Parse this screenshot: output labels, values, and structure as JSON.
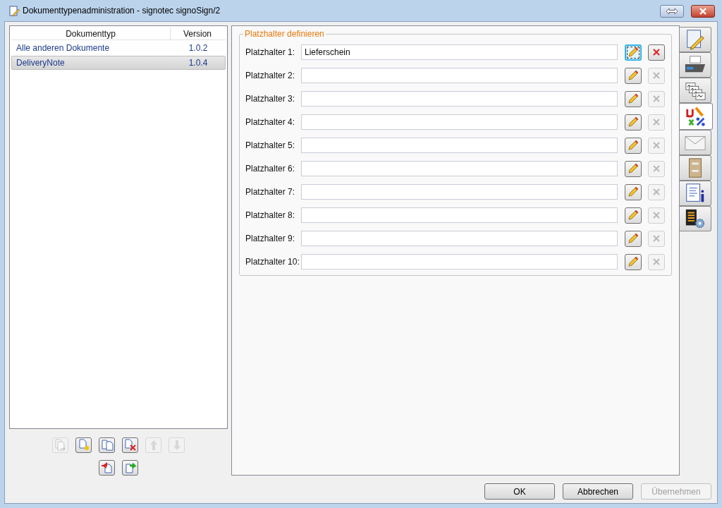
{
  "window": {
    "title": "Dokumenttypenadministration - signotec signoSign/2"
  },
  "list": {
    "columns": [
      "Dokumenttyp",
      "Version"
    ],
    "rows": [
      {
        "name": "Alle anderen Dokumente",
        "version": "1.0.2",
        "selected": false
      },
      {
        "name": "DeliveryNote",
        "version": "1.0.4",
        "selected": true
      }
    ]
  },
  "list_toolbar": [
    [
      {
        "kind": "move",
        "disabled": true
      },
      {
        "kind": "new",
        "disabled": false
      },
      {
        "kind": "copy",
        "disabled": false
      },
      {
        "kind": "delete",
        "disabled": false
      },
      {
        "kind": "up",
        "disabled": true
      },
      {
        "kind": "down",
        "disabled": true
      }
    ],
    [
      {
        "kind": "import",
        "disabled": false
      },
      {
        "kind": "export",
        "disabled": false
      }
    ]
  ],
  "group": {
    "title": "Platzhalter definieren",
    "placeholders": [
      {
        "label": "Platzhalter 1:",
        "value": "Lieferschein",
        "focused": true,
        "delete_disabled": false
      },
      {
        "label": "Platzhalter 2:",
        "focused": false,
        "delete_disabled": true
      },
      {
        "label": "Platzhalter 3:",
        "focused": false,
        "delete_disabled": true
      },
      {
        "label": "Platzhalter 4:",
        "focused": false,
        "delete_disabled": true
      },
      {
        "label": "Platzhalter 5:",
        "focused": false,
        "delete_disabled": true
      },
      {
        "label": "Platzhalter 6:",
        "focused": false,
        "delete_disabled": true
      },
      {
        "label": "Platzhalter 7:",
        "focused": false,
        "delete_disabled": true
      },
      {
        "label": "Platzhalter 8:",
        "focused": false,
        "delete_disabled": true
      },
      {
        "label": "Platzhalter 9:",
        "focused": false,
        "delete_disabled": true
      },
      {
        "label": "Platzhalter 10:",
        "focused": false,
        "delete_disabled": true
      }
    ]
  },
  "side_tabs": [
    {
      "kind": "signature",
      "selected": false
    },
    {
      "kind": "printer",
      "selected": false
    },
    {
      "kind": "signatures",
      "selected": false
    },
    {
      "kind": "placeholders",
      "selected": true
    },
    {
      "kind": "mail",
      "selected": false
    },
    {
      "kind": "archive",
      "selected": false
    },
    {
      "kind": "info",
      "selected": false
    },
    {
      "kind": "settings",
      "selected": false
    }
  ],
  "buttons": [
    {
      "label": "OK",
      "disabled": false
    },
    {
      "label": "Abbrechen",
      "disabled": false
    },
    {
      "label": "Übernehmen",
      "disabled": true
    }
  ]
}
